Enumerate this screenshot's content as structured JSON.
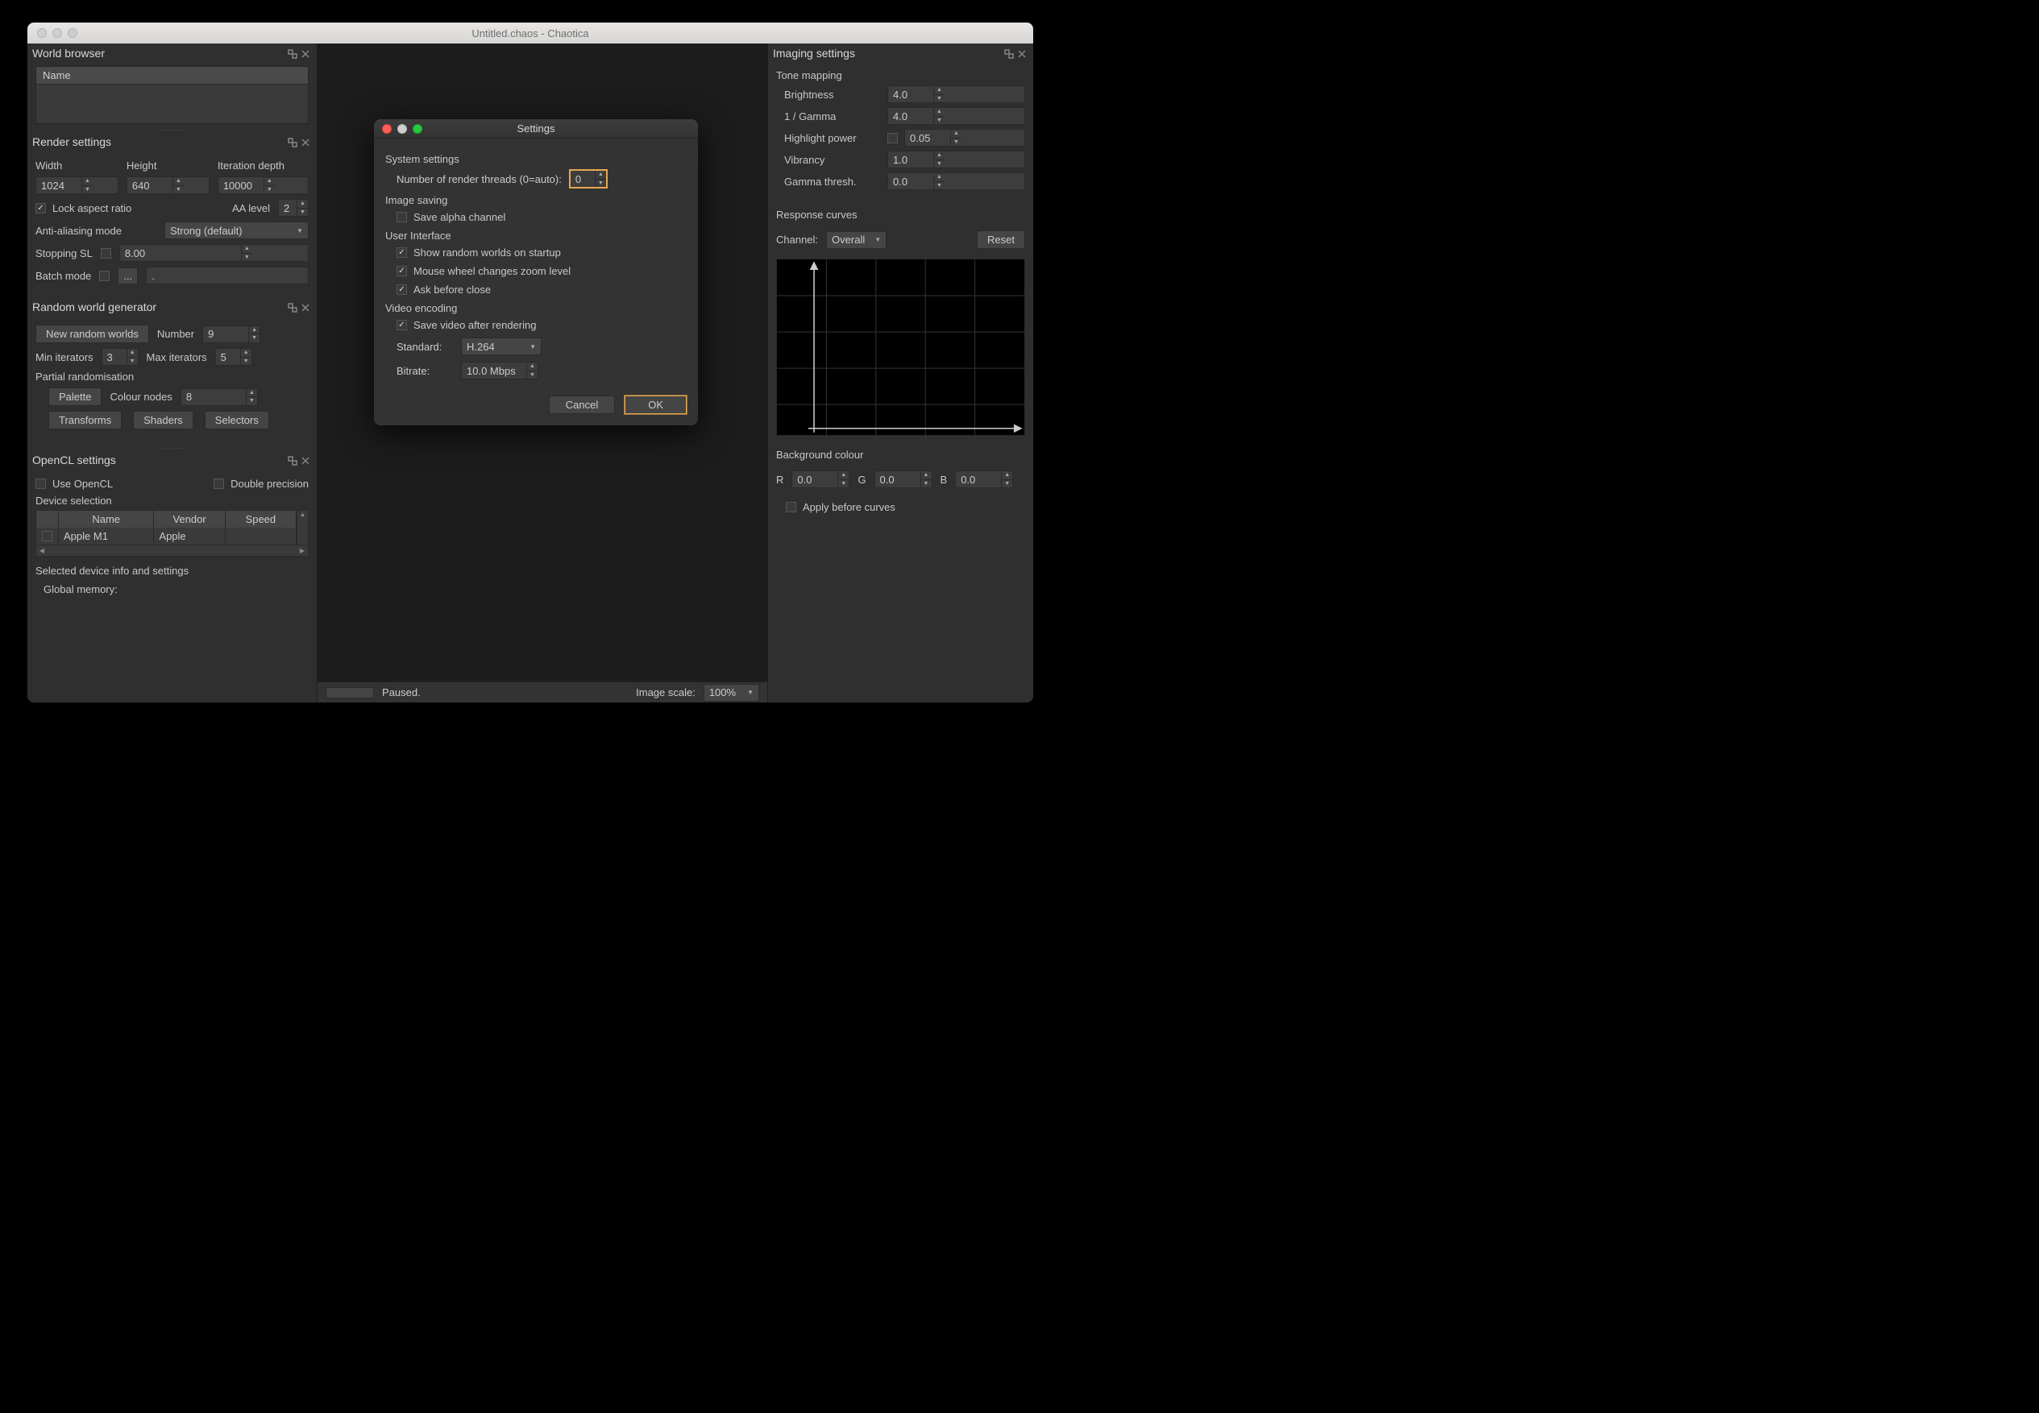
{
  "main": {
    "title": "Untitled.chaos - Chaotica"
  },
  "world_browser": {
    "title": "World browser",
    "name_header": "Name"
  },
  "render": {
    "title": "Render settings",
    "width_label": "Width",
    "width_value": "1024",
    "height_label": "Height",
    "height_value": "640",
    "iter_label": "Iteration depth",
    "iter_value": "10000",
    "lock_aspect": "Lock aspect ratio",
    "aa_label": "AA level",
    "aa_value": "2",
    "aa_mode_label": "Anti-aliasing mode",
    "aa_mode_value": "Strong (default)",
    "stop_label": "Stopping SL",
    "stop_value": "8.00",
    "batch_label": "Batch mode",
    "batch_btn": "...",
    "batch_path": "."
  },
  "random": {
    "title": "Random world generator",
    "new_btn": "New random worlds",
    "number_label": "Number",
    "number_value": "9",
    "min_label": "Min iterators",
    "min_value": "3",
    "max_label": "Max iterators",
    "max_value": "5",
    "partial_label": "Partial randomisation",
    "palette_btn": "Palette",
    "colour_nodes_label": "Colour nodes",
    "colour_nodes_value": "8",
    "transforms_btn": "Transforms",
    "shaders_btn": "Shaders",
    "selectors_btn": "Selectors"
  },
  "opencl": {
    "title": "OpenCL settings",
    "use_label": "Use OpenCL",
    "double_label": "Double precision",
    "device_sel": "Device selection",
    "col_name": "Name",
    "col_vendor": "Vendor",
    "col_speed": "Speed",
    "row_name": "Apple M1",
    "row_vendor": "Apple",
    "row_speed": "",
    "info_title": "Selected device info and settings",
    "global_mem": "Global memory:"
  },
  "status": {
    "state": "Paused.",
    "scale_label": "Image scale:",
    "scale_value": "100%"
  },
  "imaging": {
    "title": "Imaging settings",
    "tone_title": "Tone mapping",
    "brightness_label": "Brightness",
    "brightness_value": "4.0",
    "gamma_label": "1 / Gamma",
    "gamma_value": "4.0",
    "highlight_label": "Highlight power",
    "highlight_value": "0.05",
    "vibrancy_label": "Vibrancy",
    "vibrancy_value": "1.0",
    "gamma_thresh_label": "Gamma thresh.",
    "gamma_thresh_value": "0.0"
  },
  "curves": {
    "title": "Response curves",
    "channel_label": "Channel:",
    "channel_value": "Overall",
    "reset_btn": "Reset"
  },
  "bg": {
    "title": "Background colour",
    "r_label": "R",
    "r_value": "0.0",
    "g_label": "G",
    "g_value": "0.0",
    "b_label": "B",
    "b_value": "0.0",
    "apply_label": "Apply before curves"
  },
  "settings_dialog": {
    "title": "Settings",
    "system_title": "System settings",
    "threads_label": "Number of render threads (0=auto):",
    "threads_value": "0",
    "image_title": "Image saving",
    "save_alpha": "Save alpha channel",
    "ui_title": "User Interface",
    "show_random": "Show random worlds on startup",
    "mouse_zoom": "Mouse wheel changes zoom level",
    "ask_close": "Ask before close",
    "video_title": "Video encoding",
    "save_video": "Save video after rendering",
    "standard_label": "Standard:",
    "standard_value": "H.264",
    "bitrate_label": "Bitrate:",
    "bitrate_value": "10.0 Mbps",
    "cancel": "Cancel",
    "ok": "OK"
  }
}
